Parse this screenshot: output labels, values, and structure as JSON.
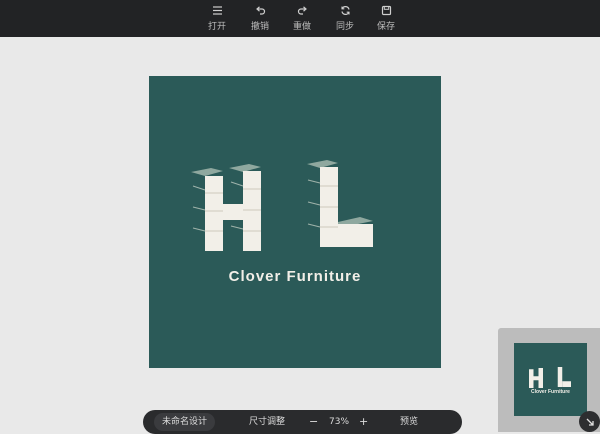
{
  "toolbar": {
    "items": [
      {
        "label": "打开",
        "icon": "menu-icon"
      },
      {
        "label": "撤销",
        "icon": "undo-icon"
      },
      {
        "label": "重做",
        "icon": "redo-icon"
      },
      {
        "label": "同步",
        "icon": "sync-icon"
      },
      {
        "label": "保存",
        "icon": "save-icon"
      }
    ]
  },
  "design": {
    "logo_letters": "HL",
    "brand_name": "Clover Furniture",
    "background_color": "#2b5a58",
    "block_color": "#f2efe8"
  },
  "bottombar": {
    "design_name": "未命名设计",
    "resize_label": "尺寸调整",
    "zoom_out": "−",
    "zoom_level": "73%",
    "zoom_in": "+",
    "preview_label": "预览"
  },
  "thumbnail": {
    "logo_letters": "HL",
    "brand_name": "Clover Furniture"
  }
}
